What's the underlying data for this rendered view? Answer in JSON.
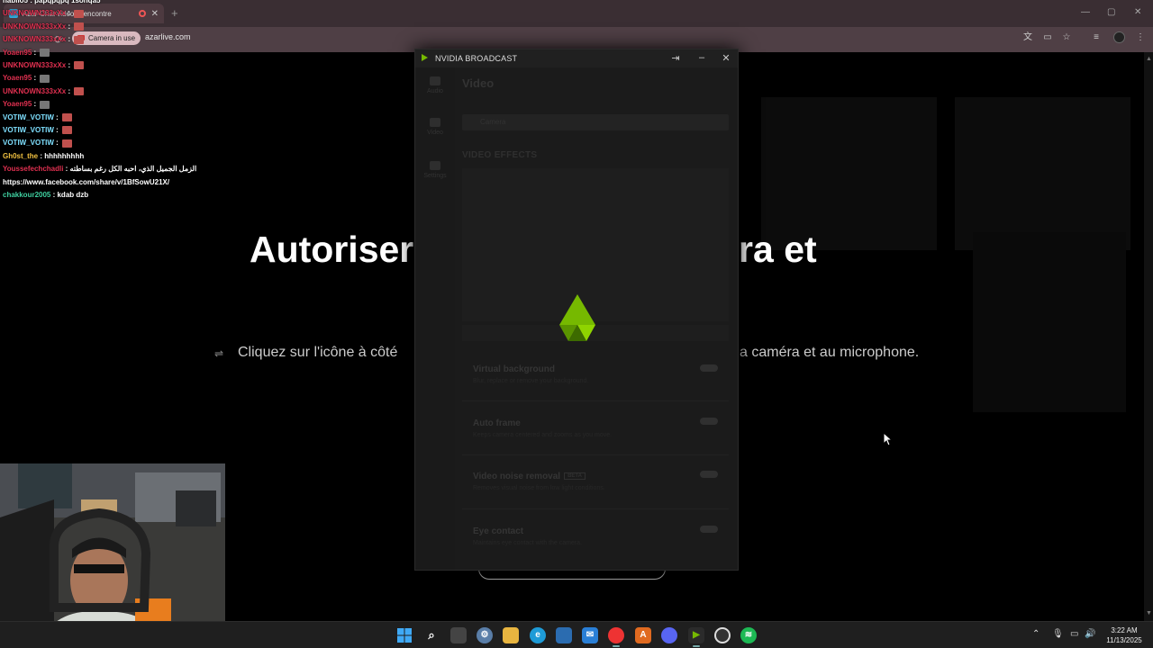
{
  "browser": {
    "tab_title": "Azar-Chat vidéo, Rencontre",
    "new_tab": "+",
    "camera_pill": "Camera in use",
    "url": "azarlive.com",
    "window_controls": [
      "—",
      "▢",
      "✕"
    ]
  },
  "page": {
    "headline_left": "Autoriser",
    "headline_right": "améra et",
    "subline_left": "Cliquez sur l'icône à côté",
    "subline_right": "a caméra et au microphone."
  },
  "chat": [
    {
      "user": "nabilo5",
      "msg": "papqpqpq 1sohqa5",
      "color": "#ffffff"
    },
    {
      "user": "UNKNOWN333xXx",
      "msg": "",
      "color": "#e03050",
      "emote": true
    },
    {
      "user": "UNKNOWN333xXx",
      "msg": "",
      "color": "#e03050",
      "emote": true
    },
    {
      "user": "UNKNOWN333xXx",
      "msg": "",
      "color": "#e03050",
      "emote": true
    },
    {
      "user": "Yoaen95",
      "msg": "",
      "color": "#e03050",
      "emote": true
    },
    {
      "user": "UNKNOWN333xXx",
      "msg": "",
      "color": "#e03050",
      "emote": true
    },
    {
      "user": "Yoaen95",
      "msg": "",
      "color": "#e03050",
      "emote": true
    },
    {
      "user": "UNKNOWN333xXx",
      "msg": "",
      "color": "#e03050",
      "emote": true
    },
    {
      "user": "Yoaen95",
      "msg": "",
      "color": "#e03050",
      "emote": true
    },
    {
      "user": "VOTIW_VOTIW",
      "msg": "",
      "color": "#7fe0ff",
      "emote": true
    },
    {
      "user": "VOTIW_VOTIW",
      "msg": "",
      "color": "#7fe0ff",
      "emote": true
    },
    {
      "user": "VOTIW_VOTIW",
      "msg": "",
      "color": "#7fe0ff",
      "emote": true
    },
    {
      "user": "Gh0st_the",
      "msg": "hhhhhhhhh",
      "color": "#f0c040"
    },
    {
      "user": "Youssefechchadli",
      "msg": "الزمل الجميل الذي، احبه الكل رغم بساطته",
      "color": "#e03050"
    },
    {
      "user": "",
      "msg": "https://www.facebook.com/share/v/1BfSowU21X/",
      "color": "#ffffff"
    },
    {
      "user": "chakkour2005",
      "msg": "kdab dzb",
      "color": "#3fd0a0"
    }
  ],
  "nvidia": {
    "title": "NVIDIA BROADCAST",
    "heading": "Video",
    "sidebar": [
      "Audio",
      "Video",
      "Settings"
    ],
    "section": "VIDEO EFFECTS",
    "source": "Camera",
    "effects": [
      {
        "name": "Virtual background",
        "desc": "Blur, replace or remove your background."
      },
      {
        "name": "Auto frame",
        "desc": "Keeps camera centered and zooms as you move."
      },
      {
        "name": "Video noise removal",
        "desc": "Removes visual noise from low light conditions.",
        "badge": "BETA"
      },
      {
        "name": "Eye contact",
        "desc": "Maintains eye contact with the camera."
      }
    ]
  },
  "taskbar": {
    "time": "3:22 AM",
    "date": "11/13/2025",
    "apps": [
      "windows-start",
      "search",
      "task-view",
      "settings",
      "file-explorer",
      "edge",
      "store",
      "mail",
      "chrome",
      "app-a",
      "discord",
      "nvidia-broadcast",
      "obs",
      "spotify"
    ]
  }
}
